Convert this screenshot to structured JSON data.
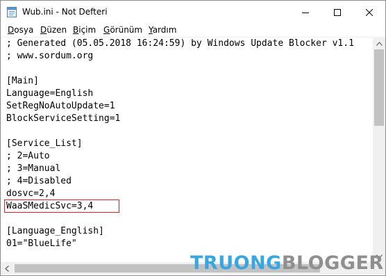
{
  "window": {
    "title": "Wub.ini - Not Defteri"
  },
  "menu": {
    "items": [
      {
        "mnemonic": "D",
        "rest": "osya"
      },
      {
        "mnemonic": "D",
        "rest": "üzen"
      },
      {
        "mnemonic": "B",
        "rest": "içim"
      },
      {
        "mnemonic": "G",
        "rest": "örünüm"
      },
      {
        "mnemonic": "Y",
        "rest": "ardım"
      }
    ]
  },
  "editor": {
    "lines": [
      "; Generated (05.05.2018 16:24:59) by Windows Update Blocker v1.1",
      "; www.sordum.org",
      "",
      "[Main]",
      "Language=English",
      "SetRegNoAutoUpdate=1",
      "BlockServiceSetting=1",
      "",
      "[Service_List]",
      "; 2=Auto",
      "; 3=Manual",
      "; 4=Disabled",
      "dosvc=2,4",
      "WaaSMedicSvc=3,4",
      "",
      "[Language_English]",
      "01=\"BlueLife\""
    ],
    "highlighted_line": "WaaSMedicSvc=3,4"
  },
  "watermark": {
    "part1": "TRUONG",
    "part2": "BLOGGER"
  },
  "colors": {
    "highlight_border": "#e02020",
    "watermark_blue": "#38a6e0",
    "watermark_gray": "#8f8f8f"
  },
  "icons": {
    "app": "notepad-icon",
    "minimize": "minimize-icon",
    "maximize": "maximize-icon",
    "close": "close-icon"
  }
}
